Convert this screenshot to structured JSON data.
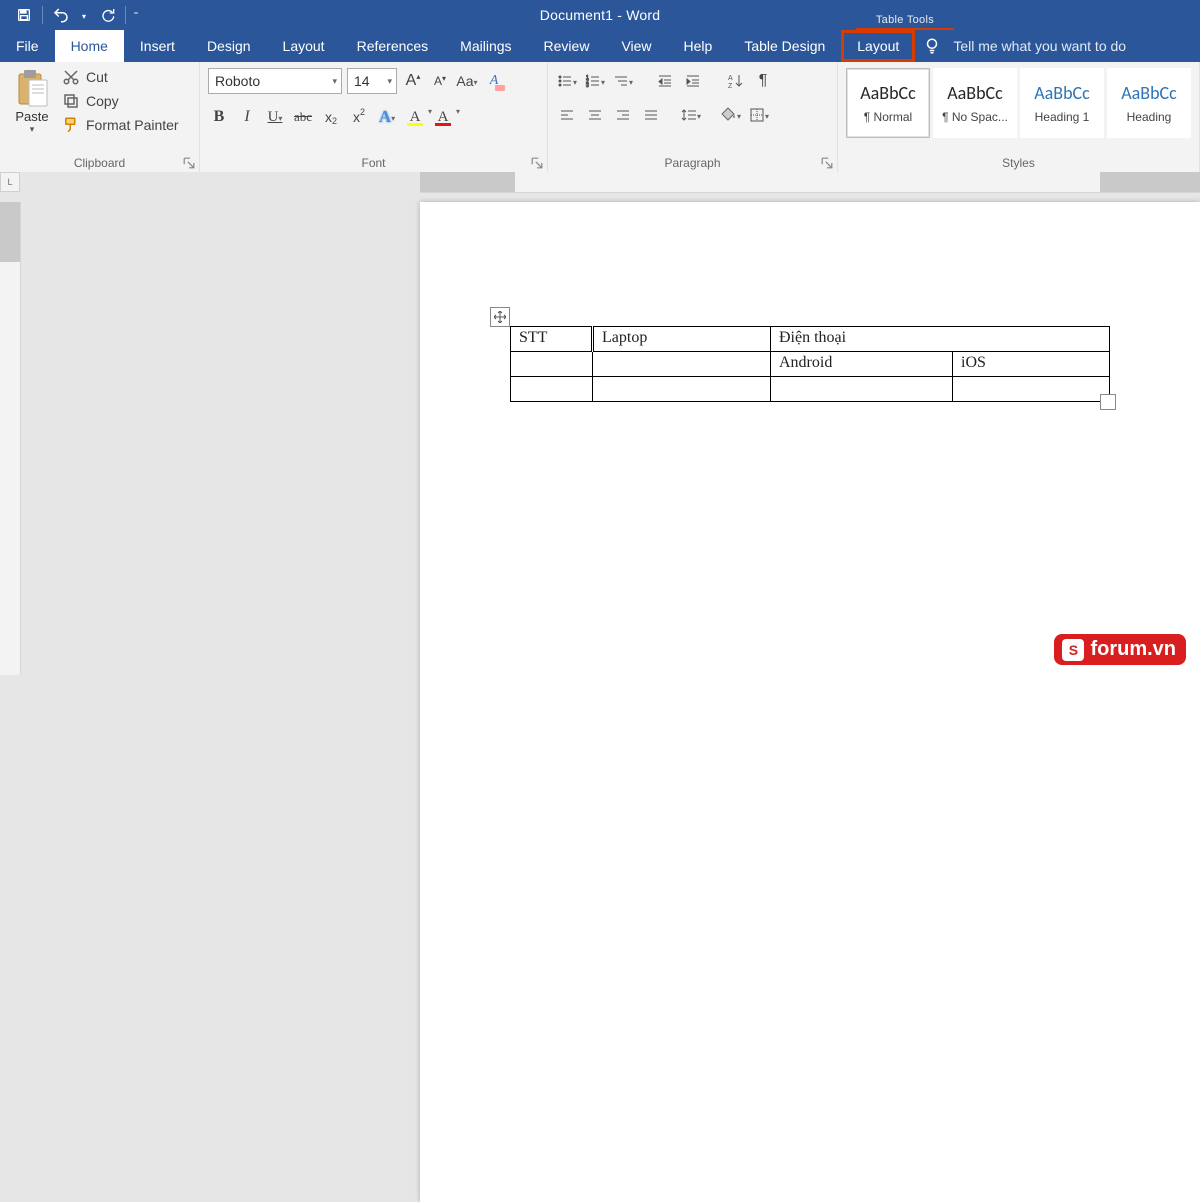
{
  "title": "Document1  -  Word",
  "contextual_tab_label": "Table Tools",
  "tabs": {
    "file": "File",
    "home": "Home",
    "insert": "Insert",
    "design": "Design",
    "layout": "Layout",
    "references": "References",
    "mailings": "Mailings",
    "review": "Review",
    "view": "View",
    "help": "Help",
    "table_design": "Table Design",
    "table_layout": "Layout"
  },
  "tell_me_placeholder": "Tell me what you want to do",
  "clipboard": {
    "group": "Clipboard",
    "paste": "Paste",
    "cut": "Cut",
    "copy": "Copy",
    "format_painter": "Format Painter"
  },
  "font": {
    "group": "Font",
    "name": "Roboto",
    "size": "14",
    "case": "Aa",
    "grow": "A",
    "shrink": "A",
    "clear": "A",
    "bold": "B",
    "italic": "I",
    "underline": "U",
    "strike": "abc",
    "sub_base": "x",
    "sub_small": "2",
    "sup_base": "x",
    "sup_small": "2",
    "texteffects": "A",
    "highlight": "A",
    "color": "A"
  },
  "paragraph": {
    "group": "Paragraph",
    "sort": "A↓Z",
    "pilcrow": "¶"
  },
  "styles": {
    "group": "Styles",
    "items": [
      {
        "preview": "AaBbCc",
        "name": "¶ Normal",
        "cls": ""
      },
      {
        "preview": "AaBbCc",
        "name": "¶ No Spac...",
        "cls": ""
      },
      {
        "preview": "AaBbCc",
        "name": "Heading 1",
        "cls": "h1"
      },
      {
        "preview": "AaBbCc",
        "name": "Heading",
        "cls": "h1"
      }
    ]
  },
  "ruler_corner": "L",
  "table": {
    "r1": {
      "c1": "STT",
      "c2": "Laptop",
      "c3": "Điện thoại",
      "c4": ""
    },
    "r2": {
      "c1": "",
      "c2": "",
      "c3": "Android",
      "c4": "iOS"
    },
    "r3": {
      "c1": "",
      "c2": "",
      "c3": "",
      "c4": ""
    }
  },
  "watermark": "forum.vn",
  "watermark_logo": "S"
}
